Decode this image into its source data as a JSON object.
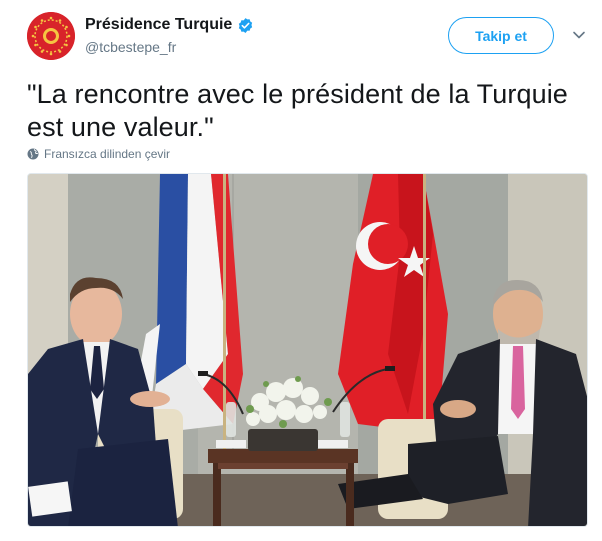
{
  "tweet": {
    "display_name": "Présidence Turquie",
    "handle": "@tcbestepe_fr",
    "text": "\"La rencontre avec le président de la Turquie est une valeur.\"",
    "translate_label": "Fransızca dilinden çevir",
    "follow_label": "Takip et",
    "verified": true
  },
  "icons": {
    "avatar": "turkish-presidential-seal",
    "verified": "verified-badge-icon",
    "menu": "chevron-down-icon",
    "translate": "globe-icon"
  },
  "colors": {
    "accent": "#1da1f2",
    "muted": "#657786",
    "seal_red": "#d8232a",
    "text": "#14171a"
  },
  "photo": {
    "subject": "tweet-photo"
  }
}
